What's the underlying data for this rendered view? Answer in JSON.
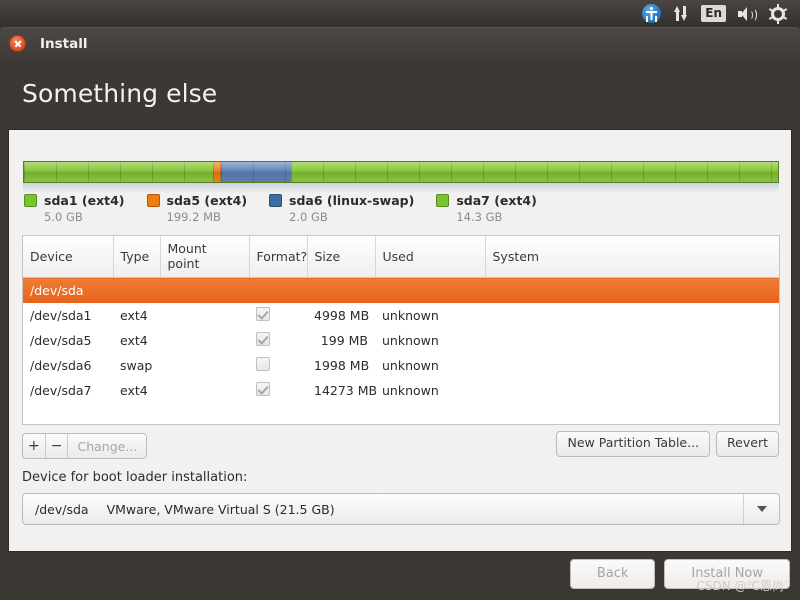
{
  "top_panel": {
    "icons": [
      {
        "name": "accessibility-icon",
        "label": "Universal Access"
      },
      {
        "name": "network-icon",
        "label": "Network"
      },
      {
        "name": "keyboard-layout-indicator",
        "label": "En"
      },
      {
        "name": "volume-icon",
        "label": "Volume"
      },
      {
        "name": "system-menu-icon",
        "label": "System"
      }
    ],
    "keyboard_layout": "En"
  },
  "window": {
    "title": "Install",
    "close_label": "×",
    "heading": "Something else"
  },
  "partition_bar": {
    "segments": [
      {
        "id": "sda1",
        "color": "#7fc02f",
        "percent": 25.1
      },
      {
        "id": "sda5",
        "color": "#e8761a",
        "percent": 1.0
      },
      {
        "id": "sda6",
        "color": "#4a71a5",
        "percent": 9.3
      },
      {
        "id": "sda7",
        "color": "#7fc02f",
        "percent": 64.6
      }
    ],
    "legend": [
      {
        "label": "sda1 (ext4)",
        "size": "5.0 GB",
        "color": "#7ac52e"
      },
      {
        "label": "sda5 (ext4)",
        "size": "199.2 MB",
        "color": "#ef7d12"
      },
      {
        "label": "sda6 (linux-swap)",
        "size": "2.0 GB",
        "color": "#3b6ea5"
      },
      {
        "label": "sda7 (ext4)",
        "size": "14.3 GB",
        "color": "#7ac52e"
      }
    ]
  },
  "table": {
    "columns": [
      "Device",
      "Type",
      "Mount point",
      "Format?",
      "Size",
      "Used",
      "System"
    ],
    "disk_row": "/dev/sda",
    "rows": [
      {
        "device": "/dev/sda1",
        "type": "ext4",
        "mount": "",
        "format": true,
        "size": "4998 MB",
        "used": "unknown",
        "system": ""
      },
      {
        "device": "/dev/sda5",
        "type": "ext4",
        "mount": "",
        "format": true,
        "size": "199 MB",
        "used": "unknown",
        "system": ""
      },
      {
        "device": "/dev/sda6",
        "type": "swap",
        "mount": "",
        "format": false,
        "size": "1998 MB",
        "used": "unknown",
        "system": ""
      },
      {
        "device": "/dev/sda7",
        "type": "ext4",
        "mount": "",
        "format": true,
        "size": "14273 MB",
        "used": "unknown",
        "system": ""
      }
    ]
  },
  "toolbar": {
    "add_label": "+",
    "remove_label": "−",
    "change_label": "Change...",
    "new_partition_table_label": "New Partition Table...",
    "revert_label": "Revert"
  },
  "boot_loader": {
    "label": "Device for boot loader installation:",
    "selected_device": "/dev/sda",
    "selected_description": "VMware, VMware Virtual S (21.5 GB)"
  },
  "footer": {
    "back_label": "Back",
    "install_label": "Install Now"
  },
  "watermark": "CSDN @℃恩尚`"
}
